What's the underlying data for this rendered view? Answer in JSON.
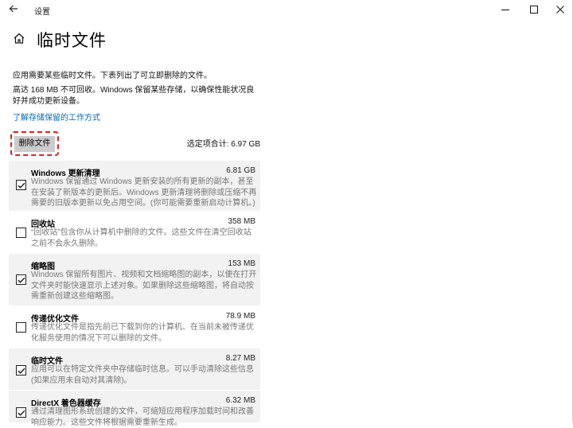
{
  "window": {
    "title": "设置"
  },
  "page": {
    "title": "临时文件",
    "intro_line1": "应用需要某些临时文件。下表列出了可立即删除的文件。",
    "intro_line2": "高达 168 MB 不可回收。Windows 保留某些存储，以确保性能状况良好并成功更新设备。",
    "learn_link": "了解存储保留的工作方式",
    "remove_button": "删除文件",
    "selected_total": "选定项合计: 6.97 GB"
  },
  "items": [
    {
      "name": "Windows 更新清理",
      "size": "6.81 GB",
      "checked": true,
      "description": "Windows 保留通过 Windows 更新安装的所有更新的副本，甚至在安装了新版本的更新后。Windows 更新清理将删除或压缩不再需要的旧版本更新以免占用空间。(你可能需要重新启动计算机。)"
    },
    {
      "name": "回收站",
      "size": "358 MB",
      "checked": false,
      "description": "“回收站”包含你从计算机中删除的文件。这些文件在清空回收站之前不会永久删除。"
    },
    {
      "name": "缩略图",
      "size": "153 MB",
      "checked": true,
      "description": "Windows 保留所有图片、视频和文档缩略图的副本，以便在打开文件夹时能快速显示上述对象。如果删除这些缩略图，将自动按需重新创建这些缩略图。"
    },
    {
      "name": "传递优化文件",
      "size": "78.9 MB",
      "checked": false,
      "description": "传递优化文件是指先前已下载到你的计算机、在当前未被传递优化服务使用的情况下可以删除的文件。"
    },
    {
      "name": "临时文件",
      "size": "8.27 MB",
      "checked": true,
      "description": "应用可以在特定文件夹中存储临时信息。可以手动清除这些信息(如果应用未自动对其清除)。"
    },
    {
      "name": "DirectX 着色器缓存",
      "size": "6.32 MB",
      "checked": true,
      "description": "通过清理图形系统创建的文件，可缩短应用程序加载时间和改善响应能力。这些文件将根据需要重新生成。"
    }
  ]
}
